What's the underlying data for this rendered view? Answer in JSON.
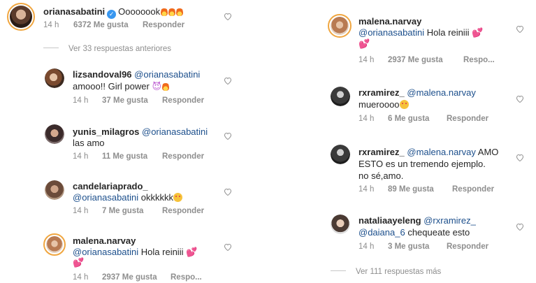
{
  "left": {
    "main_comment": {
      "username": "orianasabatini",
      "text": "Oooooook",
      "time": "14 h",
      "likes": "6372 Me gusta",
      "reply": "Responder"
    },
    "view_previous": "Ver 33 respuestas anteriores",
    "replies": [
      {
        "username": "lizsandoval96",
        "mention": "@orianasabatini",
        "text": "amooo!! Girl power",
        "time": "14 h",
        "likes": "37 Me gusta",
        "reply": "Responder"
      },
      {
        "username": "yunis_milagros",
        "mention": "@orianasabatini",
        "text": "las amo",
        "time": "14 h",
        "likes": "11 Me gusta",
        "reply": "Responder"
      },
      {
        "username": "candelariaprado_",
        "mention": "@orianasabatini",
        "text": "okkkkkk",
        "time": "14 h",
        "likes": "7 Me gusta",
        "reply": "Responder"
      },
      {
        "username": "malena.narvay",
        "mention": "@orianasabatini",
        "text": "Hola reiniii",
        "time": "14 h",
        "likes": "2937 Me gusta",
        "reply": "Respo..."
      }
    ]
  },
  "right": {
    "replies": [
      {
        "username": "malena.narvay",
        "mention": "@orianasabatini",
        "text": "Hola reiniii",
        "time": "14 h",
        "likes": "2937 Me gusta",
        "reply": "Respo..."
      },
      {
        "username": "rxramirez_",
        "mention": "@malena.narvay",
        "text": "mueroooo",
        "time": "14 h",
        "likes": "6 Me gusta",
        "reply": "Responder"
      },
      {
        "username": "rxramirez_",
        "mention": "@malena.narvay",
        "text_1": "AMO",
        "text_2": "ESTO es un tremendo ejemplo.",
        "text_3": "no sé,amo.",
        "time": "14 h",
        "likes": "89 Me gusta",
        "reply": "Responder"
      },
      {
        "username": "nataliaayeleng",
        "mention_1": "@rxramirez_",
        "mention_2": "@daiana_6",
        "text": "chequeate esto",
        "time": "14 h",
        "likes": "3 Me gusta",
        "reply": "Responder"
      }
    ],
    "view_more": "Ver 111 respuestas más"
  },
  "colors": {
    "mention": "#1c4f8c",
    "meta": "#8e8e8e",
    "verified": "#3897f0",
    "story_ring": "#f0a640"
  },
  "icons": [
    "heart-outline-icon",
    "verified-badge-icon",
    "fire-emoji-icon",
    "two-hearts-emoji-icon",
    "smiling-devil-emoji-icon",
    "heart-eyes-emoji-icon"
  ]
}
